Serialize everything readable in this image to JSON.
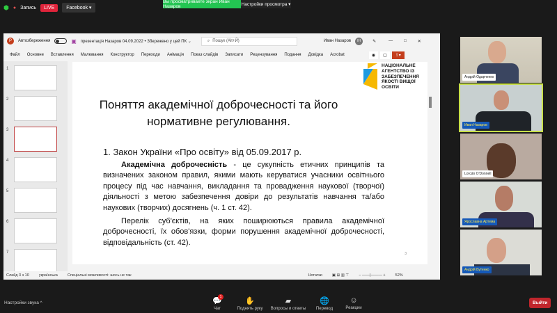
{
  "zoom_top": {
    "record": "Запись",
    "live": "LIVE",
    "stream": "Facebook ▾",
    "banner": "Вы просматриваете экран Иван Назаров",
    "view_options": "Настройки просмотра ▾"
  },
  "ppt": {
    "autosave": "Автозбереження",
    "filename": "презентація Назаров 04.09.2022 • Збережено у цей ПК ⌄",
    "search": "Пошук (Alt+Й)",
    "user": "Иван Назаров",
    "user_initials": "ІН",
    "tabs": [
      "Файл",
      "Основне",
      "Вставлення",
      "Малювання",
      "Конструктор",
      "Переходи",
      "Анімація",
      "Показ слайдів",
      "Записати",
      "Рецензування",
      "Подання",
      "Довідка",
      "Acrobat"
    ],
    "thumb_numbers": [
      "1",
      "2",
      "3",
      "4",
      "5",
      "6",
      "7"
    ],
    "status": {
      "slide": "Слайд 3 з 10",
      "lang": "українська",
      "accessibility": "Спеціальні можливості: шось не так",
      "notes": "Нотатки",
      "zoom": "52%"
    }
  },
  "slide": {
    "title": "Поняття академічної доброчесності та його нормативне регулювання.",
    "logo_text": "НАЦІОНАЛЬНЕ АГЕНТСТВО ІЗ ЗАБЕЗПЕЧЕННЯ ЯКОСТІ ВИЩОЇ ОСВІТИ",
    "heading": "1. Закон України «Про освіту» від 05.09.2017 р.",
    "term": "Академічна доброчесність",
    "para1": " - це сукупність етичних принципів та визначених законом правил, якими мають керуватися учасники освітнього процесу під час навчання, викладання та провадження наукової (творчої) діяльності з метою забезпечення довіри до результатів навчання та/або наукових (творчих) досягнень (ч. 1 ст. 42).",
    "para2": "Перелік суб'єктів, на яких поширюються правила академічної доброчесності, їх обов'язки, форми порушення академічної доброчесності, відповідальність (ст. 42).",
    "page": "3"
  },
  "participants": [
    {
      "name": "Андрій Одарченко"
    },
    {
      "name": "Иван Назаров"
    },
    {
      "name": "Lorcán O'Donnell"
    },
    {
      "name": "Ярославна Артема"
    },
    {
      "name": "Андрій Бутенко"
    }
  ],
  "bottom": {
    "audio": "Настройки звука ^",
    "chat": "Чат",
    "chat_badge": "1",
    "raise": "Поднять руку",
    "qa": "Вопросы и ответы",
    "translate": "Перевод",
    "reactions": "Реакции",
    "leave": "Выйти"
  }
}
